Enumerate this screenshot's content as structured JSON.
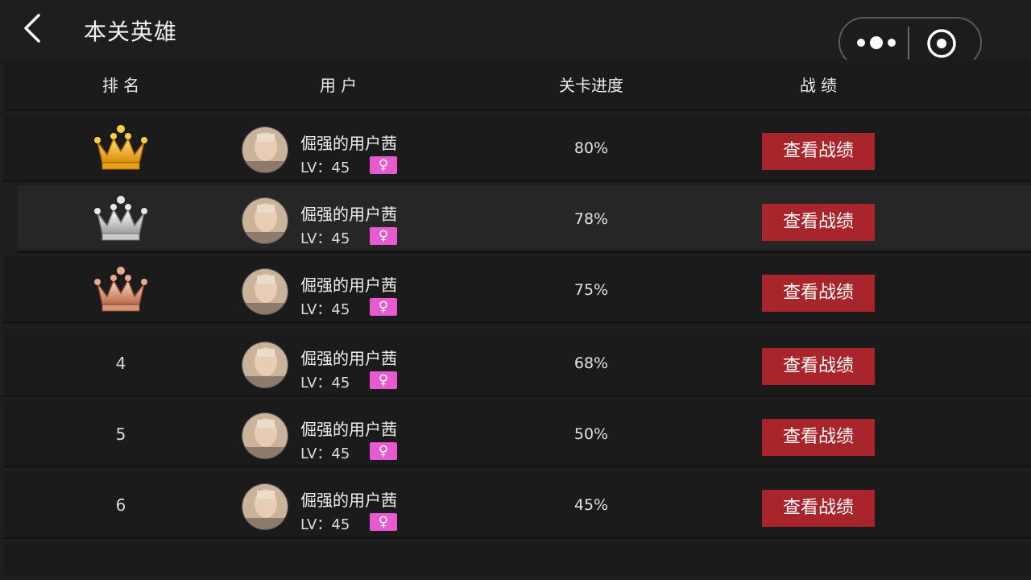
{
  "header": {
    "title": "本关英雄",
    "icons": {
      "back": "chevron-left-icon",
      "more": "more-dots-icon",
      "close": "target-circle-icon"
    }
  },
  "table": {
    "columns": [
      "排 名",
      "用 户",
      "关卡进度",
      "战  绩"
    ],
    "rows": [
      {
        "rank": "",
        "rank_icon": "gold-crown-icon",
        "user": "倔强的用户茜",
        "level": "LV：45",
        "gender": "♀",
        "progress": "80%",
        "action": "查看战绩"
      },
      {
        "rank": "",
        "rank_icon": "silver-crown-icon",
        "user": "倔强的用户茜",
        "level": "LV：45",
        "gender": "♀",
        "progress": "78%",
        "action": "查看战绩"
      },
      {
        "rank": "",
        "rank_icon": "bronze-crown-icon",
        "user": "倔强的用户茜",
        "level": "LV：45",
        "gender": "♀",
        "progress": "75%",
        "action": "查看战绩"
      },
      {
        "rank": "4",
        "user": "倔强的用户茜",
        "level": "LV：45",
        "gender": "♀",
        "progress": "68%",
        "action": "查看战绩"
      },
      {
        "rank": "5",
        "user": "倔强的用户茜",
        "level": "LV：45",
        "gender": "♀",
        "progress": "50%",
        "action": "查看战绩"
      },
      {
        "rank": "6",
        "user": "倔强的用户茜",
        "level": "LV：45",
        "gender": "♀",
        "progress": "45%",
        "action": "查看战绩"
      }
    ]
  },
  "colors": {
    "background": "#1e1e1e",
    "button": "#a8252b",
    "gender_badge": "#e85bd0",
    "gold": "#f2b21c",
    "silver": "#c9c9c9",
    "bronze": "#d9957a"
  }
}
